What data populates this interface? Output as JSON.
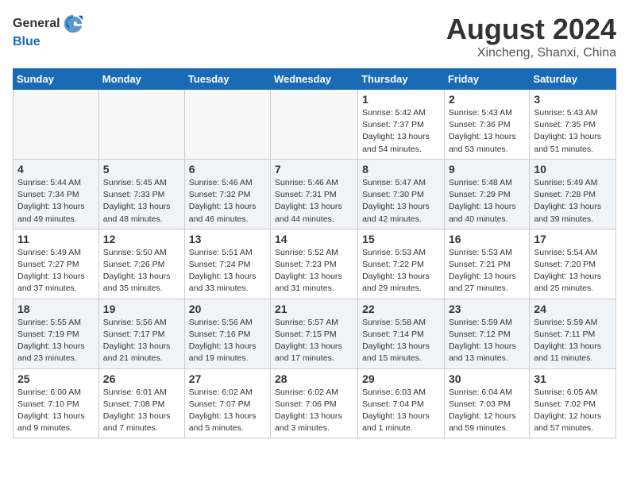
{
  "header": {
    "logo_general": "General",
    "logo_blue": "Blue",
    "month_year": "August 2024",
    "location": "Xincheng, Shanxi, China"
  },
  "weekdays": [
    "Sunday",
    "Monday",
    "Tuesday",
    "Wednesday",
    "Thursday",
    "Friday",
    "Saturday"
  ],
  "weeks": [
    [
      {
        "day": "",
        "info": ""
      },
      {
        "day": "",
        "info": ""
      },
      {
        "day": "",
        "info": ""
      },
      {
        "day": "",
        "info": ""
      },
      {
        "day": "1",
        "info": "Sunrise: 5:42 AM\nSunset: 7:37 PM\nDaylight: 13 hours\nand 54 minutes."
      },
      {
        "day": "2",
        "info": "Sunrise: 5:43 AM\nSunset: 7:36 PM\nDaylight: 13 hours\nand 53 minutes."
      },
      {
        "day": "3",
        "info": "Sunrise: 5:43 AM\nSunset: 7:35 PM\nDaylight: 13 hours\nand 51 minutes."
      }
    ],
    [
      {
        "day": "4",
        "info": "Sunrise: 5:44 AM\nSunset: 7:34 PM\nDaylight: 13 hours\nand 49 minutes."
      },
      {
        "day": "5",
        "info": "Sunrise: 5:45 AM\nSunset: 7:33 PM\nDaylight: 13 hours\nand 48 minutes."
      },
      {
        "day": "6",
        "info": "Sunrise: 5:46 AM\nSunset: 7:32 PM\nDaylight: 13 hours\nand 46 minutes."
      },
      {
        "day": "7",
        "info": "Sunrise: 5:46 AM\nSunset: 7:31 PM\nDaylight: 13 hours\nand 44 minutes."
      },
      {
        "day": "8",
        "info": "Sunrise: 5:47 AM\nSunset: 7:30 PM\nDaylight: 13 hours\nand 42 minutes."
      },
      {
        "day": "9",
        "info": "Sunrise: 5:48 AM\nSunset: 7:29 PM\nDaylight: 13 hours\nand 40 minutes."
      },
      {
        "day": "10",
        "info": "Sunrise: 5:49 AM\nSunset: 7:28 PM\nDaylight: 13 hours\nand 39 minutes."
      }
    ],
    [
      {
        "day": "11",
        "info": "Sunrise: 5:49 AM\nSunset: 7:27 PM\nDaylight: 13 hours\nand 37 minutes."
      },
      {
        "day": "12",
        "info": "Sunrise: 5:50 AM\nSunset: 7:26 PM\nDaylight: 13 hours\nand 35 minutes."
      },
      {
        "day": "13",
        "info": "Sunrise: 5:51 AM\nSunset: 7:24 PM\nDaylight: 13 hours\nand 33 minutes."
      },
      {
        "day": "14",
        "info": "Sunrise: 5:52 AM\nSunset: 7:23 PM\nDaylight: 13 hours\nand 31 minutes."
      },
      {
        "day": "15",
        "info": "Sunrise: 5:53 AM\nSunset: 7:22 PM\nDaylight: 13 hours\nand 29 minutes."
      },
      {
        "day": "16",
        "info": "Sunrise: 5:53 AM\nSunset: 7:21 PM\nDaylight: 13 hours\nand 27 minutes."
      },
      {
        "day": "17",
        "info": "Sunrise: 5:54 AM\nSunset: 7:20 PM\nDaylight: 13 hours\nand 25 minutes."
      }
    ],
    [
      {
        "day": "18",
        "info": "Sunrise: 5:55 AM\nSunset: 7:19 PM\nDaylight: 13 hours\nand 23 minutes."
      },
      {
        "day": "19",
        "info": "Sunrise: 5:56 AM\nSunset: 7:17 PM\nDaylight: 13 hours\nand 21 minutes."
      },
      {
        "day": "20",
        "info": "Sunrise: 5:56 AM\nSunset: 7:16 PM\nDaylight: 13 hours\nand 19 minutes."
      },
      {
        "day": "21",
        "info": "Sunrise: 5:57 AM\nSunset: 7:15 PM\nDaylight: 13 hours\nand 17 minutes."
      },
      {
        "day": "22",
        "info": "Sunrise: 5:58 AM\nSunset: 7:14 PM\nDaylight: 13 hours\nand 15 minutes."
      },
      {
        "day": "23",
        "info": "Sunrise: 5:59 AM\nSunset: 7:12 PM\nDaylight: 13 hours\nand 13 minutes."
      },
      {
        "day": "24",
        "info": "Sunrise: 5:59 AM\nSunset: 7:11 PM\nDaylight: 13 hours\nand 11 minutes."
      }
    ],
    [
      {
        "day": "25",
        "info": "Sunrise: 6:00 AM\nSunset: 7:10 PM\nDaylight: 13 hours\nand 9 minutes."
      },
      {
        "day": "26",
        "info": "Sunrise: 6:01 AM\nSunset: 7:08 PM\nDaylight: 13 hours\nand 7 minutes."
      },
      {
        "day": "27",
        "info": "Sunrise: 6:02 AM\nSunset: 7:07 PM\nDaylight: 13 hours\nand 5 minutes."
      },
      {
        "day": "28",
        "info": "Sunrise: 6:02 AM\nSunset: 7:06 PM\nDaylight: 13 hours\nand 3 minutes."
      },
      {
        "day": "29",
        "info": "Sunrise: 6:03 AM\nSunset: 7:04 PM\nDaylight: 13 hours\nand 1 minute."
      },
      {
        "day": "30",
        "info": "Sunrise: 6:04 AM\nSunset: 7:03 PM\nDaylight: 12 hours\nand 59 minutes."
      },
      {
        "day": "31",
        "info": "Sunrise: 6:05 AM\nSunset: 7:02 PM\nDaylight: 12 hours\nand 57 minutes."
      }
    ]
  ]
}
